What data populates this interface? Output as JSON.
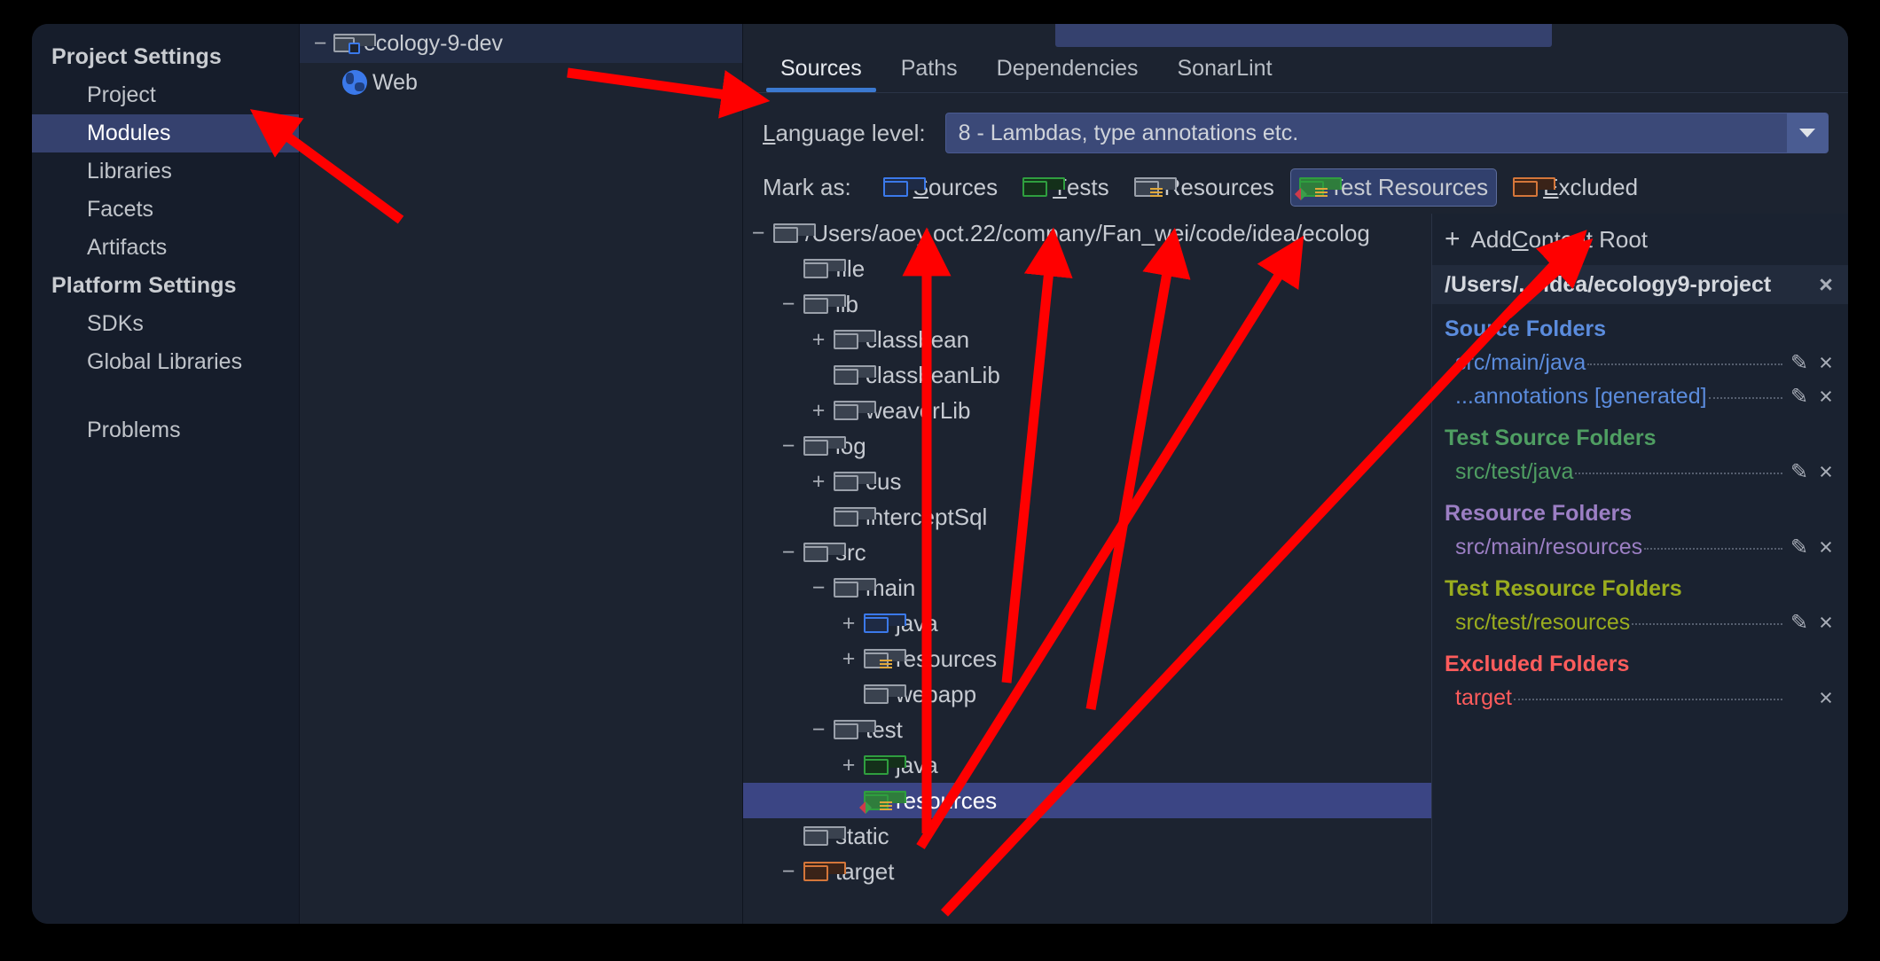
{
  "sidebar": {
    "groups": [
      {
        "title": "Project Settings",
        "items": [
          {
            "label": "Project",
            "selected": false
          },
          {
            "label": "Modules",
            "selected": true
          },
          {
            "label": "Libraries",
            "selected": false
          },
          {
            "label": "Facets",
            "selected": false
          },
          {
            "label": "Artifacts",
            "selected": false
          }
        ]
      },
      {
        "title": "Platform Settings",
        "items": [
          {
            "label": "SDKs",
            "selected": false
          },
          {
            "label": "Global Libraries",
            "selected": false
          }
        ]
      }
    ],
    "problems_label": "Problems"
  },
  "modules": {
    "rows": [
      {
        "label": "ecology-9-dev",
        "twisty": "−",
        "icon": "module-icon",
        "indent": 0,
        "header": true
      },
      {
        "label": "Web",
        "twisty": "",
        "icon": "globe-icon",
        "indent": 1,
        "header": false
      }
    ]
  },
  "tabs": [
    {
      "label": "Sources",
      "active": true
    },
    {
      "label": "Paths",
      "active": false
    },
    {
      "label": "Dependencies",
      "active": false
    },
    {
      "label": "SonarLint",
      "active": false
    }
  ],
  "language_level": {
    "label_prefix": "",
    "label_underlined": "L",
    "label_rest": "anguage level:",
    "value": "8 - Lambdas, type annotations etc."
  },
  "mark_as": {
    "label": "Mark as:",
    "buttons": [
      {
        "underlined": "S",
        "rest": "ources",
        "icon": "folder-blue-icon",
        "selected": false
      },
      {
        "underlined": "T",
        "rest": "ests",
        "icon": "folder-green-icon",
        "selected": false
      },
      {
        "underlined": "",
        "rest": "Resources",
        "icon": "folder-resources-icon",
        "selected": false
      },
      {
        "underlined": "",
        "rest": "Test Resources",
        "icon": "folder-test-resources-icon",
        "selected": true
      },
      {
        "underlined": "E",
        "rest": "xcluded",
        "icon": "folder-orange-icon",
        "selected": false
      }
    ]
  },
  "tree": [
    {
      "label": "/Users/aoey.oct.22/company/Fan_wei/code/idea/ecolog",
      "twisty": "−",
      "icon": "folder-dark-icon",
      "indent": 0,
      "selected": false
    },
    {
      "label": "file",
      "twisty": "",
      "icon": "folder-dark-icon",
      "indent": 1,
      "selected": false
    },
    {
      "label": "lib",
      "twisty": "−",
      "icon": "folder-dark-icon",
      "indent": 1,
      "selected": false
    },
    {
      "label": "classbean",
      "twisty": "+",
      "icon": "folder-dark-icon",
      "indent": 2,
      "selected": false
    },
    {
      "label": "classbeanLib",
      "twisty": "",
      "icon": "folder-dark-icon",
      "indent": 2,
      "selected": false
    },
    {
      "label": "weaverLib",
      "twisty": "+",
      "icon": "folder-dark-icon",
      "indent": 2,
      "selected": false
    },
    {
      "label": "log",
      "twisty": "−",
      "icon": "folder-dark-icon",
      "indent": 1,
      "selected": false
    },
    {
      "label": "cus",
      "twisty": "+",
      "icon": "folder-dark-icon",
      "indent": 2,
      "selected": false
    },
    {
      "label": "interceptSql",
      "twisty": "",
      "icon": "folder-dark-icon",
      "indent": 2,
      "selected": false
    },
    {
      "label": "src",
      "twisty": "−",
      "icon": "folder-dark-icon",
      "indent": 1,
      "selected": false
    },
    {
      "label": "main",
      "twisty": "−",
      "icon": "folder-dark-icon",
      "indent": 2,
      "selected": false
    },
    {
      "label": "java",
      "twisty": "+",
      "icon": "folder-blue-icon",
      "indent": 3,
      "selected": false
    },
    {
      "label": "resources",
      "twisty": "+",
      "icon": "folder-resources-icon",
      "indent": 3,
      "selected": false
    },
    {
      "label": "webapp",
      "twisty": "",
      "icon": "folder-dark-icon",
      "indent": 3,
      "selected": false
    },
    {
      "label": "test",
      "twisty": "−",
      "icon": "folder-dark-icon",
      "indent": 2,
      "selected": false
    },
    {
      "label": "java",
      "twisty": "+",
      "icon": "folder-green-icon",
      "indent": 3,
      "selected": false
    },
    {
      "label": "resources",
      "twisty": "",
      "icon": "folder-test-resources-icon",
      "indent": 3,
      "selected": true
    },
    {
      "label": "static",
      "twisty": "",
      "icon": "folder-dark-icon",
      "indent": 1,
      "selected": false
    },
    {
      "label": "target",
      "twisty": "−",
      "icon": "folder-orange-icon",
      "indent": 1,
      "selected": false
    }
  ],
  "details": {
    "add_content_root": {
      "plus": "+",
      "pre": "Add ",
      "underlined": "C",
      "post": "ontent Root"
    },
    "root_header": "/Users/.../idea/ecology9-project",
    "sections": [
      {
        "title": "Source Folders",
        "color": "#5b8cdd",
        "rows": [
          {
            "name": "src/main/java",
            "has_pencil": true,
            "has_close": true
          },
          {
            "name": "...annotations [generated]",
            "has_pencil": true,
            "has_close": true
          }
        ]
      },
      {
        "title": "Test Source Folders",
        "color": "#4f9e62",
        "rows": [
          {
            "name": "src/test/java",
            "has_pencil": true,
            "has_close": true
          }
        ]
      },
      {
        "title": "Resource Folders",
        "color": "#9c7fc4",
        "rows": [
          {
            "name": "src/main/resources",
            "has_pencil": true,
            "has_close": true
          }
        ]
      },
      {
        "title": "Test Resource Folders",
        "color": "#9aad1e",
        "rows": [
          {
            "name": "src/test/resources",
            "has_pencil": true,
            "has_close": true
          }
        ]
      },
      {
        "title": "Excluded Folders",
        "color": "#ff5c5c",
        "rows": [
          {
            "name": "target",
            "has_pencil": false,
            "has_close": true
          }
        ]
      }
    ],
    "pencil_glyph": "✎",
    "close_glyph": "×"
  },
  "colors": {
    "accent_blue": "#3b79d0",
    "selection": "#3b4584",
    "sidebar_selection": "#35416e",
    "annotation_red": "#FF0000"
  }
}
